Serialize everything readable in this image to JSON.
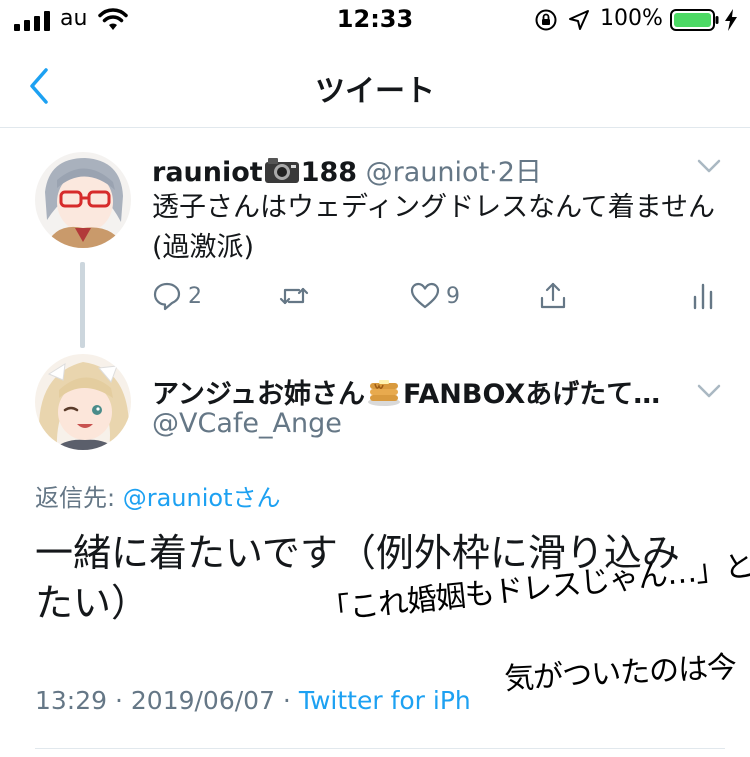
{
  "status_bar": {
    "carrier": "au",
    "time": "12:33",
    "battery_percent": "100%",
    "battery_color": "#4cd964"
  },
  "nav": {
    "title": "ツイート",
    "back_icon": "chevron-left-icon"
  },
  "colors": {
    "accent": "#1da1f2",
    "secondary_text": "#657786",
    "primary_text": "#14171a",
    "divider": "#e1e8ed"
  },
  "parent_tweet": {
    "display_name": "rauniot",
    "name_emoji": "camera-icon",
    "name_suffix": "188",
    "handle": "@rauniot",
    "separator": "·",
    "date": "2日",
    "text": "透子さんはウェディングドレスなんて着ません(過激派)",
    "reply_count": "2",
    "like_count": "9"
  },
  "main_tweet": {
    "display_name_prefix": "アンジュお姉さん",
    "name_emoji": "pancakes-icon",
    "display_name_suffix": "FANBOXあげたて…",
    "handle": "@VCafe_Ange",
    "reply_to_label": "返信先: ",
    "reply_to_handle": "@rauniotさん",
    "text": "一緒に着たいです（例外枠に滑り込みたい）",
    "time": "13:29",
    "meta_separator": " · ",
    "date": "2019/06/07",
    "client": "Twitter for iPh"
  },
  "handwriting": {
    "line1": "「これ婚姻もドレスじゃん…」と",
    "line2": "気がついたのは今"
  }
}
